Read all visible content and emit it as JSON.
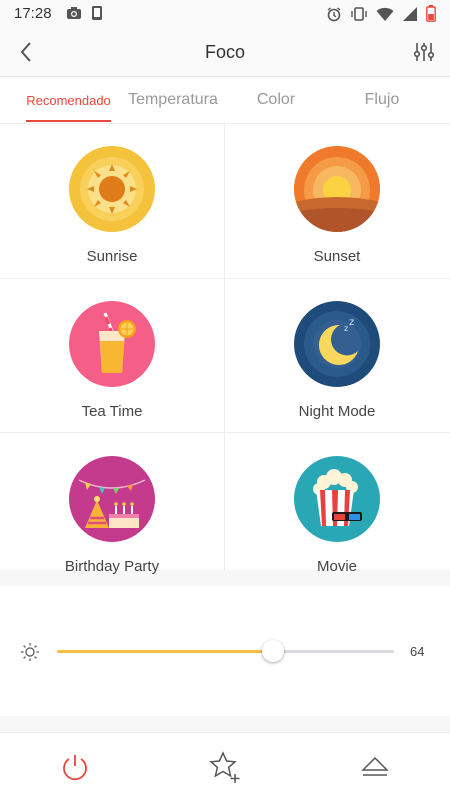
{
  "status_bar": {
    "time": "17:28",
    "left_icons": [
      "camera-icon",
      "phone-screen-icon"
    ],
    "right_icons": [
      "alarm-icon",
      "vibrate-icon",
      "wifi-icon",
      "signal-icon",
      "battery-low-icon"
    ]
  },
  "header": {
    "title": "Foco",
    "back_icon": "chevron-left-icon",
    "filter_icon": "sliders-icon"
  },
  "tabs": [
    {
      "label": "Recomendado",
      "active": true
    },
    {
      "label": "Temperatura",
      "active": false
    },
    {
      "label": "Color",
      "active": false
    },
    {
      "label": "Flujo",
      "active": false
    }
  ],
  "scenes": [
    {
      "label": "Sunrise",
      "icon": "sunrise-icon",
      "color": "#f5c23b"
    },
    {
      "label": "Sunset",
      "icon": "sunset-icon",
      "color": "#ef7a2b"
    },
    {
      "label": "Tea Time",
      "icon": "juice-glass-icon",
      "color": "#f45e87"
    },
    {
      "label": "Night Mode",
      "icon": "moon-icon",
      "color": "#1f4b7a"
    },
    {
      "label": "Birthday Party",
      "icon": "party-hat-cake-icon",
      "color": "#c43a8c"
    },
    {
      "label": "Movie",
      "icon": "popcorn-3d-glasses-icon",
      "color": "#2aa7b4"
    }
  ],
  "brightness": {
    "icon": "brightness-icon",
    "value": 64,
    "value_text": "64",
    "accent": "#f7c045"
  },
  "bottom_bar": {
    "power_icon": "power-icon",
    "favorite_icon": "star-add-icon",
    "eject_icon": "eject-icon",
    "power_color": "#e8483b"
  }
}
